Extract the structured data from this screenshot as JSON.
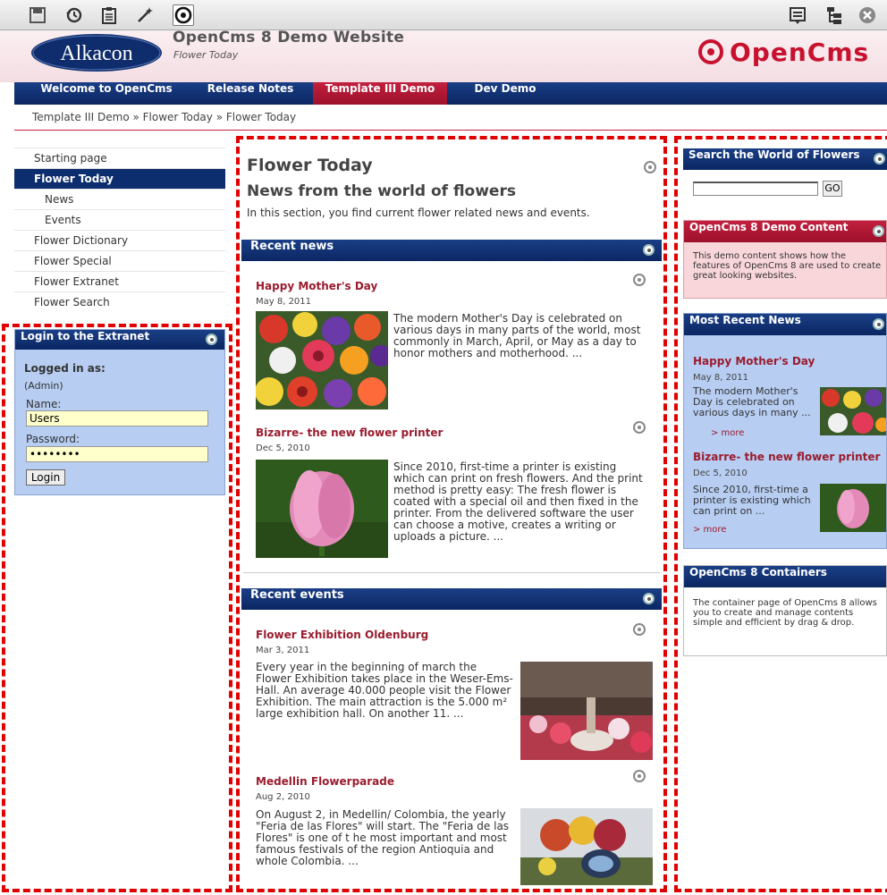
{
  "site": {
    "alkacon_logo": "Alkacon",
    "title": "OpenCms 8 Demo Website",
    "subtitle": "Flower Today",
    "opencms_logo": "OpenCms",
    "brand_red": "#c8112e",
    "brand_navy": "#0b2662"
  },
  "nav": {
    "items": [
      "Welcome to OpenCms",
      "Release Notes",
      "Template III Demo",
      "Dev Demo"
    ],
    "active": "Template III Demo"
  },
  "breadcrumb": {
    "parts": [
      "Template III Demo",
      "Flower Today",
      "Flower Today"
    ],
    "sep": "»"
  },
  "leftnav": {
    "items": [
      "Starting page",
      "Flower Today",
      "News",
      "Events",
      "Flower Dictionary",
      "Flower Special",
      "Flower Extranet",
      "Flower Search"
    ],
    "active": "Flower Today"
  },
  "login": {
    "title": "Login to the Extranet",
    "logged_in_as": "Logged in as:",
    "user": "(Admin)",
    "name_label": "Name:",
    "name_value": "Users",
    "password_label": "Password:",
    "password_value": "••••••••",
    "button": "Login"
  },
  "main": {
    "title": "Flower Today",
    "subtitle": "News from the world of flowers",
    "description": "In this section, you find current flower related news and events.",
    "recent_news": {
      "heading": "Recent news",
      "articles": [
        {
          "title": "Happy Mother's Day",
          "date": "May 8, 2011",
          "text": "The modern Mother's Day is celebrated on various days in many parts of the world, most commonly in March, April, or May as a day to honor mothers and motherhood. ..."
        },
        {
          "title": "Bizarre- the new flower printer",
          "date": "Dec 5, 2010",
          "text": "Since 2010, first-time a printer is existing which can print on fresh flowers. And the print method is pretty easy: The fresh flower is coated with a special oil and then fixed in the printer. From the delivered software the user can choose a motive, creates a writing or uploads a picture. ..."
        }
      ]
    },
    "recent_events": {
      "heading": "Recent events",
      "articles": [
        {
          "title": "Flower Exhibition Oldenburg",
          "date": "Mar 3, 2011",
          "text": "Every year in the beginning of march the Flower Exhibition takes place in the Weser-Ems-Hall. An average 40.000 people visit the Flower Exhibition. The main attraction is the 5.000 m² large exhibition hall. On another 11. ..."
        },
        {
          "title": "Medellin Flowerparade",
          "date": "Aug 2, 2010",
          "text": "On August 2, in Medellin/ Colombia, the yearly \"Feria de las Flores\" will start. The \"Feria de las Flores\" is one of t he most important and most famous festivals of the region Antioquia and whole Colombia. ..."
        }
      ]
    }
  },
  "right": {
    "search": {
      "heading": "Search the World of Flowers",
      "button": "GO",
      "value": ""
    },
    "demo_content": {
      "heading": "OpenCms 8 Demo Content",
      "text": "This demo content shows how the features of OpenCms 8 are used to create great looking websites."
    },
    "most_recent": {
      "heading": "Most Recent News",
      "items": [
        {
          "title": "Happy Mother's Day",
          "date": "May 8, 2011",
          "text": "The modern Mother's Day is celebrated on various days in many ...",
          "more": "> more"
        },
        {
          "title": "Bizarre- the new flower printer",
          "date": "Dec 5, 2010",
          "text": "Since 2010, first-time a printer is existing which can print on ...",
          "more": "> more"
        }
      ]
    },
    "containers": {
      "heading": "OpenCms 8 Containers",
      "text": "The container page of OpenCms 8 allows you to create and manage contents simple and efficient by drag & drop."
    }
  }
}
